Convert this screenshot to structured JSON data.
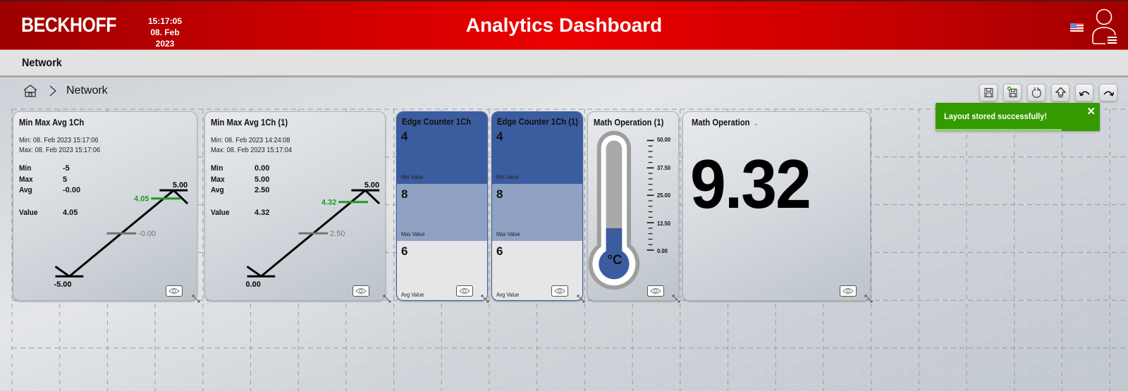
{
  "header": {
    "logo": "BECKHOFF",
    "time": "15:17:05",
    "date": "08. Feb 2023",
    "title": "Analytics Dashboard",
    "language_icon": "us-flag-icon",
    "user_icon": "user-menu-icon"
  },
  "page": {
    "title": "Network"
  },
  "breadcrumb": {
    "home_icon": "home-icon",
    "separator_icon": "chevron-right-icon",
    "current": "Network"
  },
  "toolbar": {
    "buttons": [
      {
        "name": "save",
        "icon": "floppy-disk-icon"
      },
      {
        "name": "save-as",
        "icon": "floppy-disk-new-icon"
      },
      {
        "name": "reset",
        "icon": "reset-icon"
      },
      {
        "name": "upload",
        "icon": "upload-arrow-icon"
      },
      {
        "name": "undo",
        "icon": "undo-icon"
      },
      {
        "name": "redo",
        "icon": "redo-icon"
      }
    ]
  },
  "toast": {
    "message": "Layout stored successfully!",
    "close_label": "✕",
    "progress": 0.77,
    "color": "#349a00"
  },
  "colors": {
    "brand_red": "#e00000",
    "edge_min": "#3b5d9f",
    "edge_max": "#8fa2c4",
    "edge_avg": "#e6e6e6",
    "value_marker": "#1e9a1e",
    "avg_marker": "#707070",
    "thermo_fill": "#3b5d9f"
  },
  "tiles": {
    "mma1": {
      "title": "Min Max Avg 1Ch",
      "min_time_label": "Min:  08. Feb 2023 15:17:06",
      "max_time_label": "Max: 08. Feb 2023 15:17:06",
      "labels": {
        "min": "Min",
        "max": "Max",
        "avg": "Avg",
        "value": "Value"
      },
      "min": "-5",
      "max": "5",
      "avg": "-0.00",
      "value": "4.05",
      "gauge": {
        "min": -5,
        "max": 5,
        "avg": 0,
        "value": 4.05,
        "min_label": "-5.00",
        "max_label": "5.00",
        "avg_label": "-0.00",
        "value_label": "4.05"
      }
    },
    "mma2": {
      "title": "Min Max Avg 1Ch (1)",
      "min_time_label": "Min:  08. Feb 2023 14:24:08",
      "max_time_label": "Max: 08. Feb 2023 15:17:04",
      "labels": {
        "min": "Min",
        "max": "Max",
        "avg": "Avg",
        "value": "Value"
      },
      "min": "0.00",
      "max": "5.00",
      "avg": "2.50",
      "value": "4.32",
      "gauge": {
        "min": 0,
        "max": 5,
        "avg": 2.5,
        "value": 4.32,
        "min_label": "0.00",
        "max_label": "5.00",
        "avg_label": "2.50",
        "value_label": "4.32"
      }
    },
    "ec1": {
      "title": "Edge Counter 1Ch",
      "min_value": "4",
      "min_label": "Min Value",
      "max_value": "8",
      "max_label": "Max Value",
      "avg_value": "6",
      "avg_label": "Avg Value"
    },
    "ec2": {
      "title": "Edge Counter 1Ch (1)",
      "min_value": "4",
      "min_label": "Min Value",
      "max_value": "8",
      "max_label": "Max Value",
      "avg_value": "6",
      "avg_label": "Avg Value"
    },
    "thermo": {
      "title": "Math Operation (1)",
      "unit": "°C",
      "scale_labels": [
        "50.00",
        "37.50",
        "25.00",
        "12.50",
        "0.00"
      ],
      "scale_min": 0,
      "scale_max": 50,
      "fill_fraction": 0.2
    },
    "math": {
      "title": "Math Operation",
      "chevron": "⌄",
      "value": "9.32"
    }
  }
}
